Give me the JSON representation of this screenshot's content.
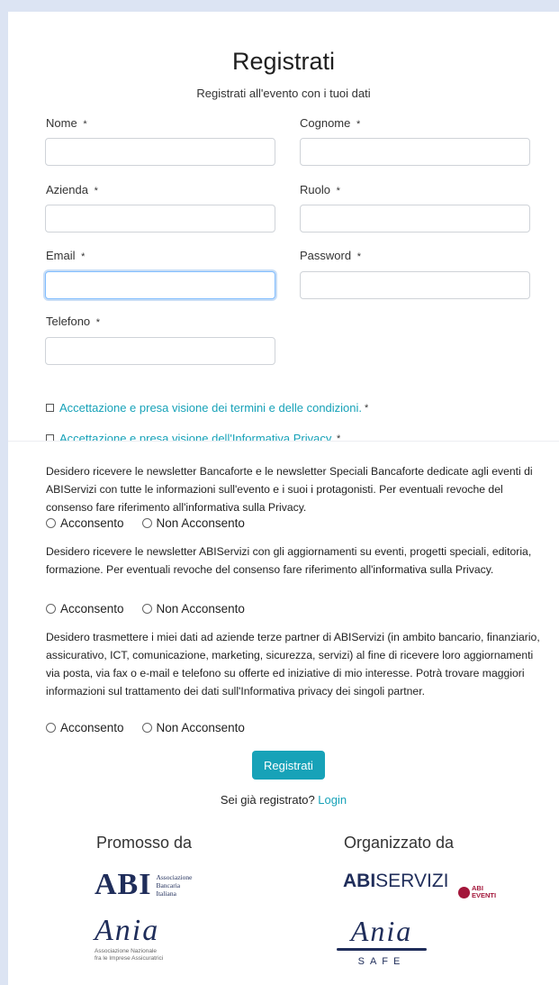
{
  "form": {
    "title": "Registrati",
    "subtitle": "Registrati all'evento con i tuoi dati",
    "fields": {
      "nome": {
        "label": "Nome",
        "value": ""
      },
      "cognome": {
        "label": "Cognome",
        "value": ""
      },
      "azienda": {
        "label": "Azienda",
        "value": ""
      },
      "ruolo": {
        "label": "Ruolo",
        "value": ""
      },
      "email": {
        "label": "Email",
        "value": ""
      },
      "password": {
        "label": "Password",
        "value": ""
      },
      "telefono": {
        "label": "Telefono",
        "value": ""
      }
    },
    "required_mark": "*",
    "checks": {
      "terms": "Accettazione e presa visione dei termini e delle condizioni.",
      "privacy": "Accettazione e presa visione dell'Informativa Privacy."
    }
  },
  "consents": {
    "c1": "Desidero ricevere le newsletter Bancaforte e le newsletter Speciali Bancaforte dedicate agli eventi di ABIServizi con tutte le informazioni sull'evento e i suoi i protagonisti. Per eventuali revoche del consenso fare riferimento all'informativa sulla Privacy.",
    "c2": "Desidero ricevere le newsletter ABIServizi con gli aggiornamenti su eventi, progetti speciali, editoria, formazione. Per eventuali revoche del consenso fare riferimento all'informativa sulla Privacy.",
    "c3": "Desidero trasmettere i miei dati ad aziende terze partner di ABIServizi (in ambito bancario, finanziario, assicurativo, ICT, comunicazione, marketing, sicurezza, servizi) al fine di ricevere loro aggiornamenti via posta, via fax o e-mail e telefono su offerte ed iniziative di mio interesse. Potrà trovare maggiori informazioni sul trattamento dei dati sull'Informativa privacy dei singoli partner.",
    "accept_label": "Acconsento",
    "decline_label": "Non Acconsento"
  },
  "submit": {
    "label": "Registrati"
  },
  "login": {
    "prompt": "Sei già registrato?",
    "link": "Login"
  },
  "logos": {
    "promoted_by": "Promosso da",
    "organized_by": "Organizzato da",
    "abi": {
      "mark": "ABI",
      "line1": "Associazione",
      "line2": "Bancaria",
      "line3": "Italiana"
    },
    "ania": {
      "mark": "Ania",
      "line1": "Associazione Nazionale",
      "line2": "fra le Imprese Assicuratrici"
    },
    "abiservizi": {
      "bold": "ABI",
      "rest": "SERVIZI",
      "eventi_line1": "ABI",
      "eventi_line2": "EVENTI"
    },
    "ania_safe": {
      "mark": "Ania",
      "sub": "SAFE"
    }
  },
  "colors": {
    "accent": "#17a2b8",
    "page_bg": "#dce4f3",
    "navy": "#1f2d5a",
    "eventi_red": "#a3163a"
  }
}
